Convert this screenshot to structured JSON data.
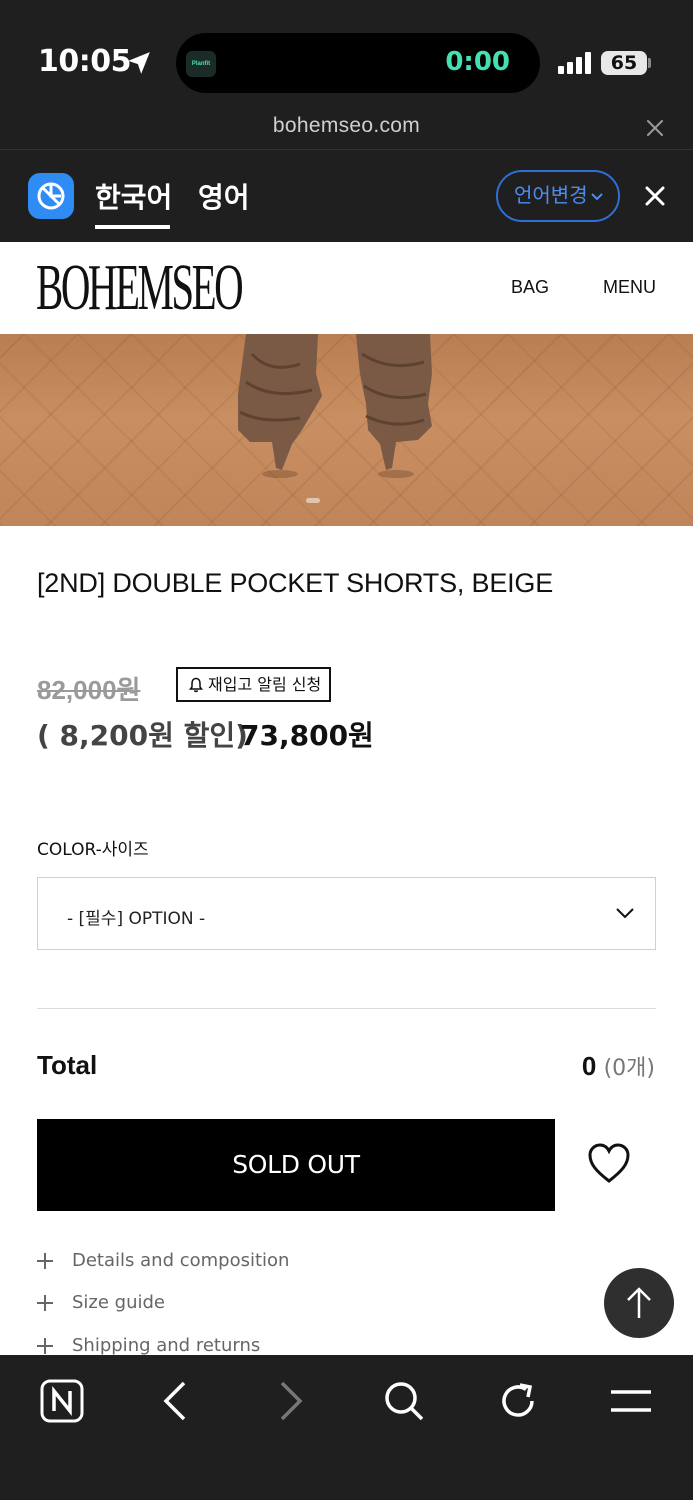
{
  "status_bar": {
    "time": "10:05",
    "island_app": "Planfit",
    "island_timer": "0:00",
    "battery": "65"
  },
  "browser": {
    "url": "bohemseo.com"
  },
  "translate_bar": {
    "tab_korean": "한국어",
    "tab_english": "영어",
    "change_language": "언어변경"
  },
  "site_header": {
    "brand": "BOHEMSEO",
    "nav_bag": "BAG",
    "nav_menu": "MENU"
  },
  "product": {
    "title": "[2ND] DOUBLE POCKET SHORTS, BEIGE",
    "price_original": "82,000원",
    "restock_label": "재입고 알림 신청",
    "discount_text": "( 8,200원 할인)",
    "price_final": "73,800원",
    "option_label": "COLOR-사이즈",
    "option_placeholder": "- [필수] OPTION -",
    "total_label": "Total",
    "total_amount": "0",
    "total_count": "(0개)",
    "soldout_label": "SOLD OUT"
  },
  "accordion": [
    {
      "label": "Details and composition"
    },
    {
      "label": "Size guide"
    },
    {
      "label": "Shipping and returns"
    }
  ],
  "colors": {
    "browser_chrome": "#1f1f1f",
    "accent_blue": "#2f8cf5",
    "timer_green": "#43e0b4"
  },
  "icons": [
    "location-arrow-icon",
    "signal-icon",
    "battery-icon",
    "close-icon",
    "translate-logo-icon",
    "chevron-down-icon",
    "bell-icon",
    "heart-icon",
    "plus-icon",
    "arrow-up-icon",
    "naver-icon",
    "back-icon",
    "forward-icon",
    "search-icon",
    "refresh-icon",
    "menu-icon"
  ]
}
